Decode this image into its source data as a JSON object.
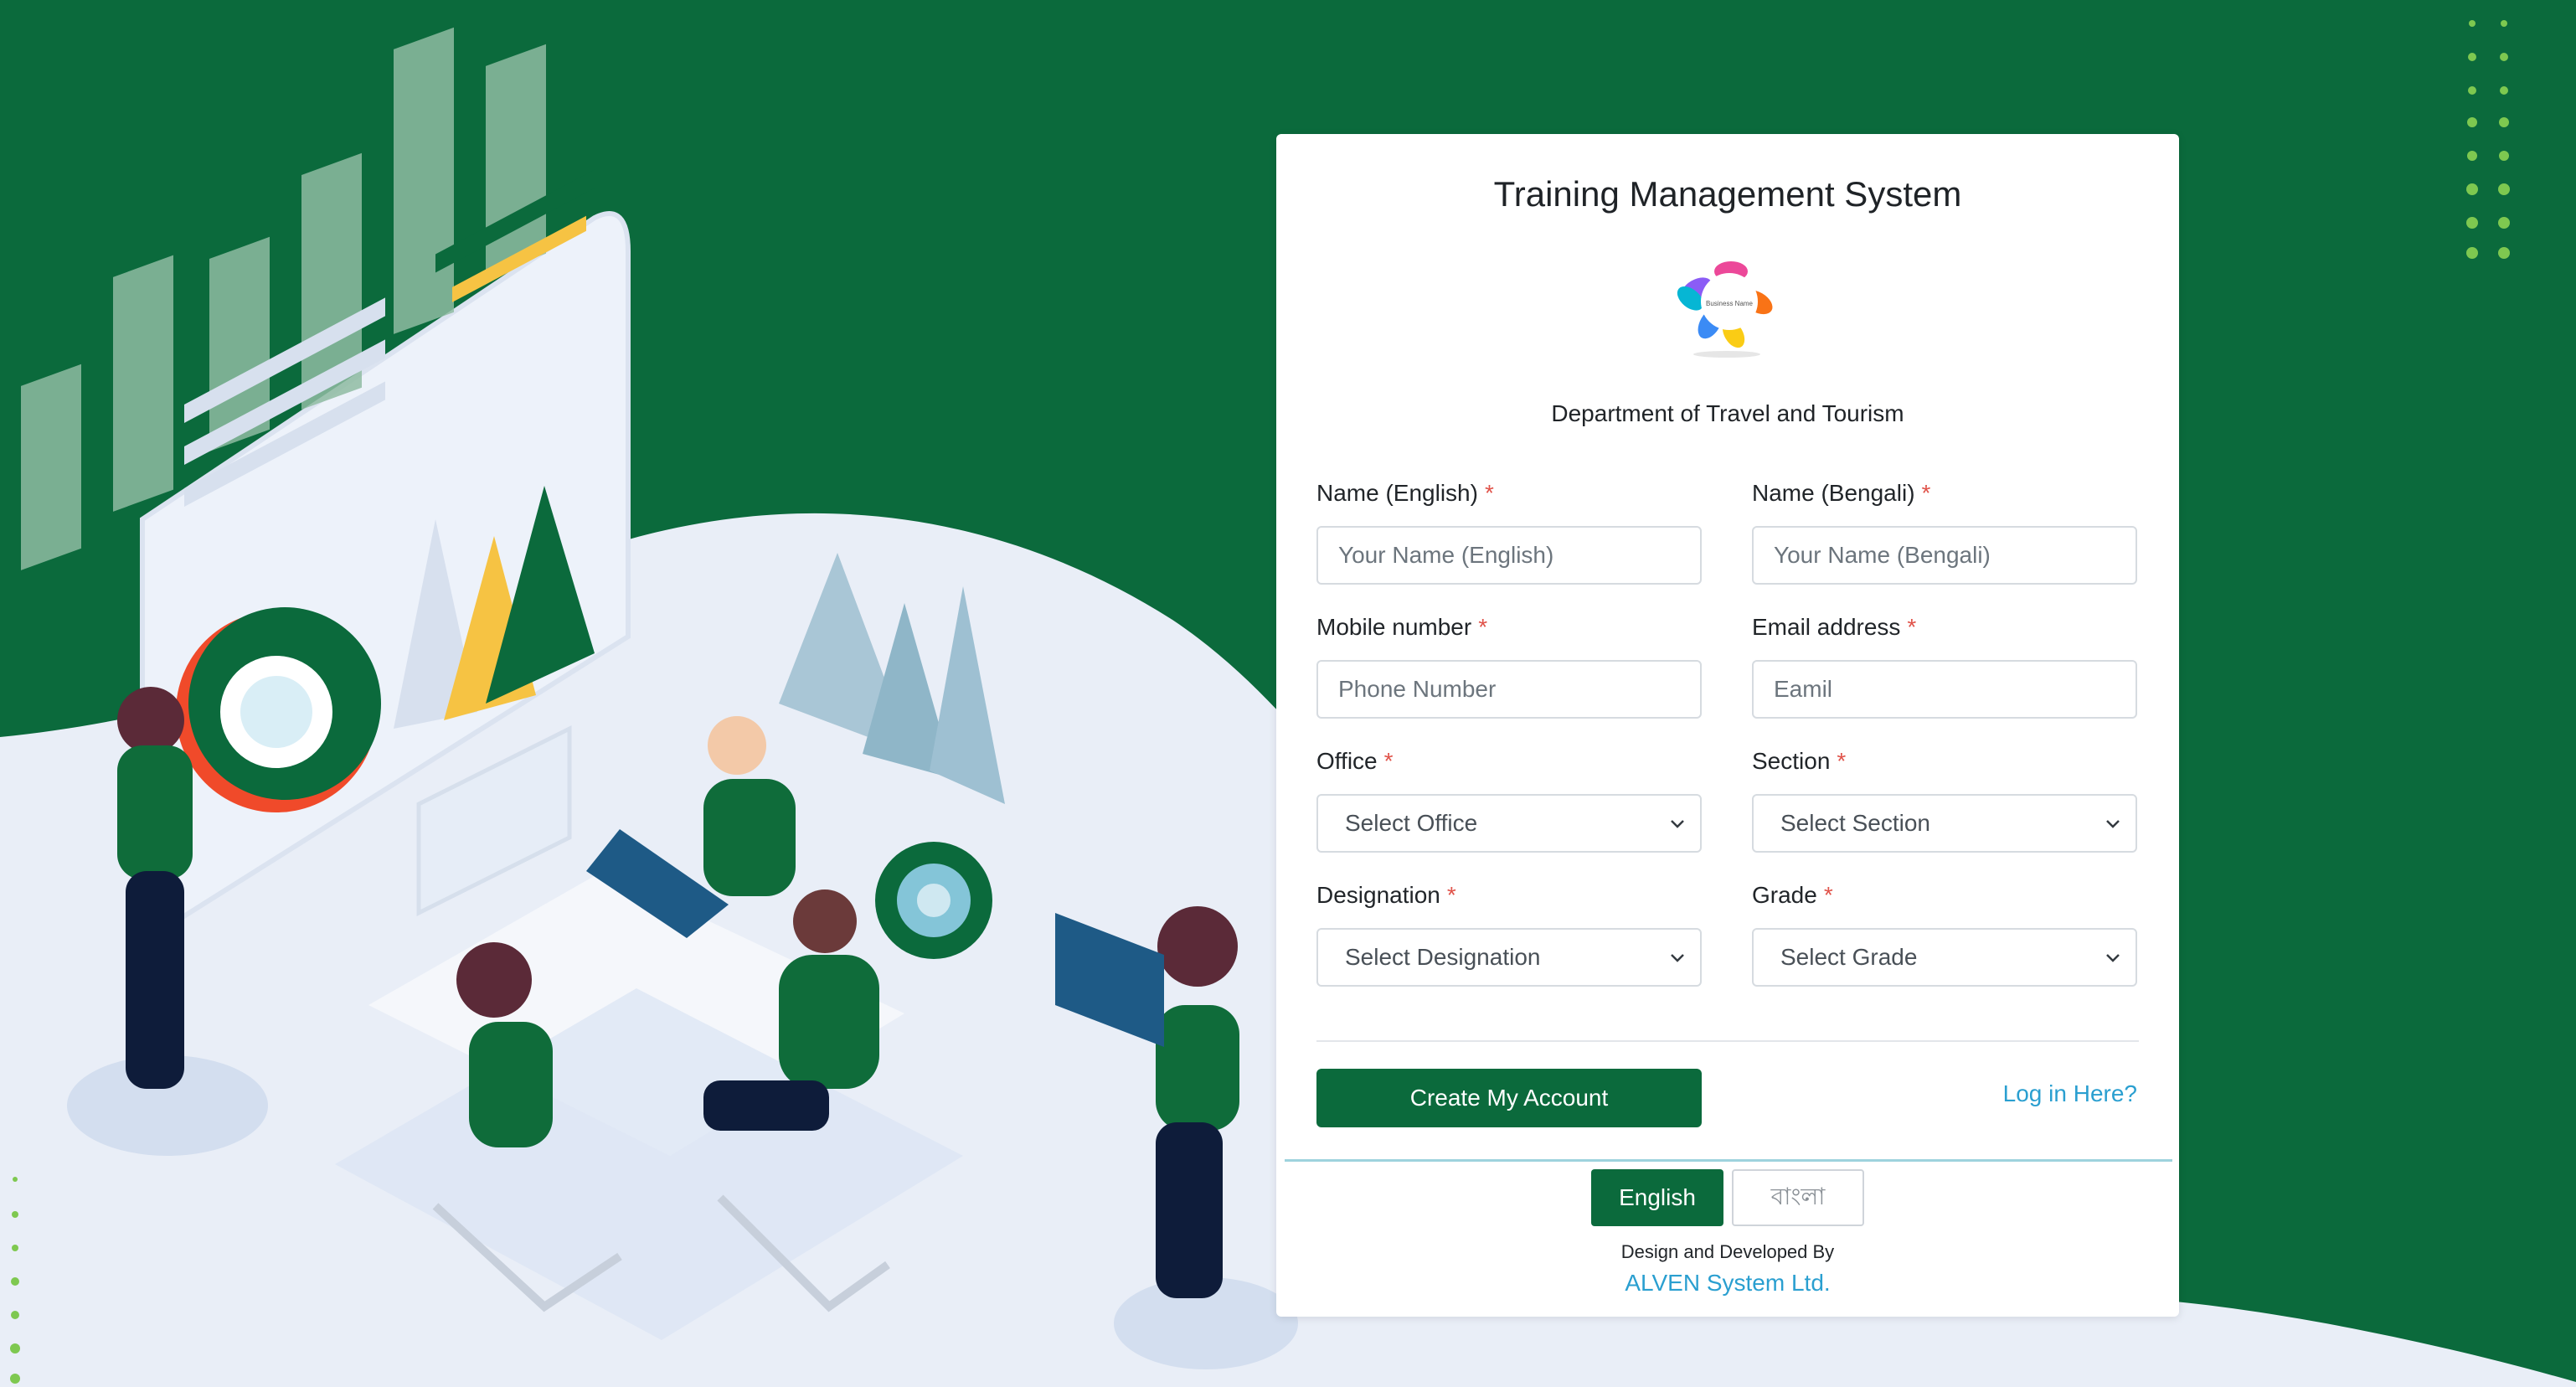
{
  "form": {
    "title": "Training Management System",
    "logo_text": "Business Name",
    "department": "Department of Travel and Tourism",
    "fields": {
      "name_english": {
        "label": "Name (English)",
        "placeholder": "Your Name (English)"
      },
      "name_bengali": {
        "label": "Name (Bengali)",
        "placeholder": "Your Name (Bengali)"
      },
      "mobile": {
        "label": "Mobile number",
        "placeholder": "Phone Number"
      },
      "email": {
        "label": "Email address",
        "placeholder": "Eamil"
      },
      "office": {
        "label": "Office",
        "selected": "Select Office"
      },
      "section": {
        "label": "Section",
        "selected": "Select Section"
      },
      "designation": {
        "label": "Designation",
        "selected": "Select Designation"
      },
      "grade": {
        "label": "Grade",
        "selected": "Select Grade"
      }
    },
    "required_mark": "*",
    "create_button": "Create My Account",
    "login_link": "Log in Here?"
  },
  "language": {
    "english": "English",
    "bangla": "বাংলা",
    "active": "English"
  },
  "footer": {
    "credit": "Design and Developed By",
    "company": "ALVEN System Ltd."
  },
  "colors": {
    "brand_green": "#0b6a3c",
    "link_blue": "#2a9fd0",
    "required_red": "#e0534a",
    "background": "#e9eef7"
  }
}
